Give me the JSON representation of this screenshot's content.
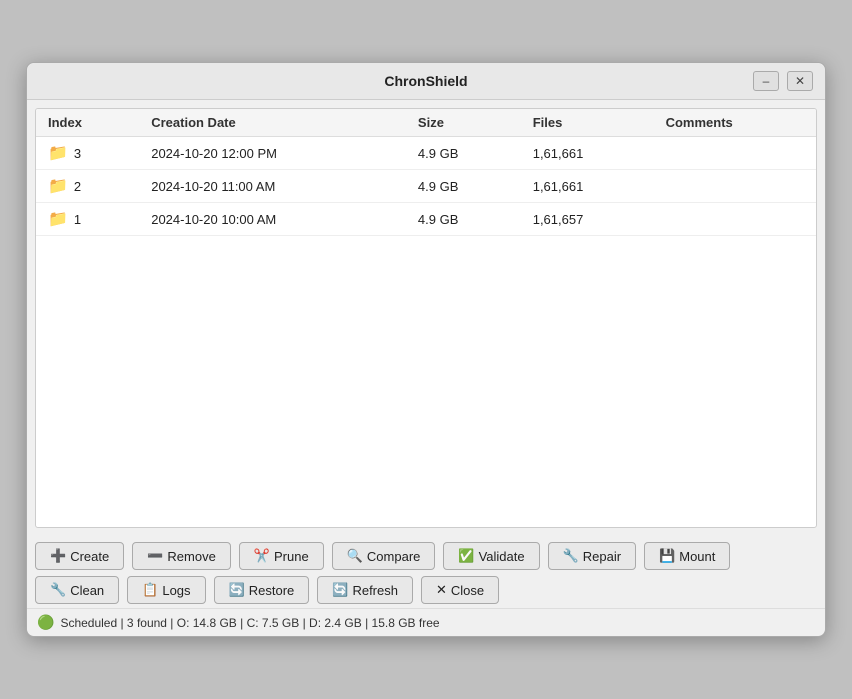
{
  "window": {
    "title": "ChronShield",
    "minimize_label": "–",
    "close_label": "✕"
  },
  "table": {
    "columns": [
      "Index",
      "Creation Date",
      "Size",
      "Files",
      "Comments"
    ],
    "rows": [
      {
        "index": "3",
        "creation_date": "2024-10-20 12:00 PM",
        "size": "4.9 GB",
        "files": "1,61,661",
        "comments": ""
      },
      {
        "index": "2",
        "creation_date": "2024-10-20 11:00 AM",
        "size": "4.9 GB",
        "files": "1,61,661",
        "comments": ""
      },
      {
        "index": "1",
        "creation_date": "2024-10-20 10:00 AM",
        "size": "4.9 GB",
        "files": "1,61,657",
        "comments": ""
      }
    ]
  },
  "buttons": {
    "row1": [
      {
        "id": "create",
        "icon": "➕",
        "label": "Create"
      },
      {
        "id": "remove",
        "icon": "➖",
        "label": "Remove"
      },
      {
        "id": "prune",
        "icon": "✂️",
        "label": "Prune"
      },
      {
        "id": "compare",
        "icon": "🔍",
        "label": "Compare"
      },
      {
        "id": "validate",
        "icon": "✅",
        "label": "Validate"
      },
      {
        "id": "repair",
        "icon": "🔧",
        "label": "Repair"
      },
      {
        "id": "mount",
        "icon": "💾",
        "label": "Mount"
      }
    ],
    "row2": [
      {
        "id": "clean",
        "icon": "🔧",
        "label": "Clean"
      },
      {
        "id": "logs",
        "icon": "📋",
        "label": "Logs"
      },
      {
        "id": "restore",
        "icon": "🔄",
        "label": "Restore"
      },
      {
        "id": "refresh",
        "icon": "🔄",
        "label": "Refresh"
      },
      {
        "id": "close",
        "icon": "✕",
        "label": "Close"
      }
    ]
  },
  "status": {
    "icon": "🟢",
    "text": "Scheduled | 3 found | O: 14.8 GB | C: 7.5 GB | D: 2.4 GB | 15.8 GB free"
  }
}
